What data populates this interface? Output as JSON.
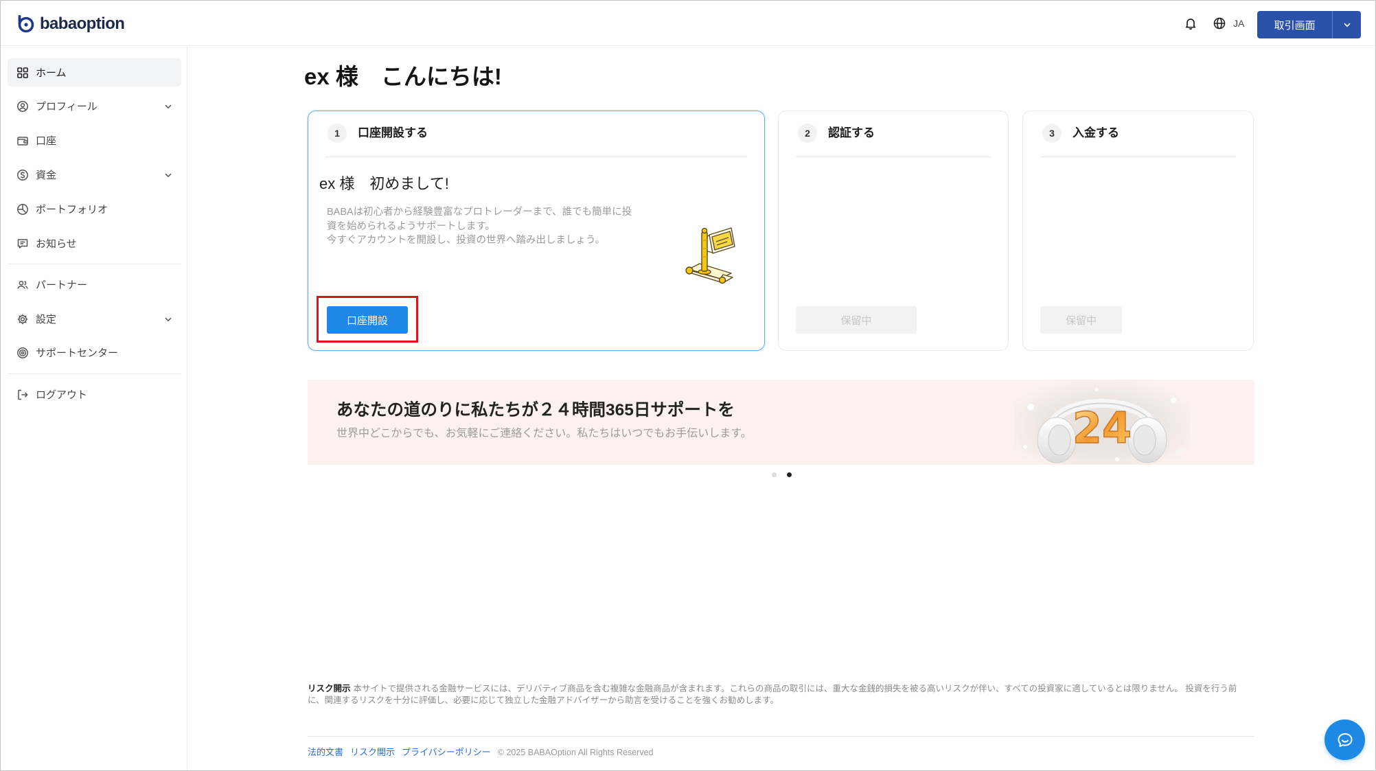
{
  "header": {
    "logo_text": "babaoption",
    "logo_icon": "babaoption-logo-icon",
    "notification_icon": "bell-icon",
    "language_icon": "globe-icon",
    "language": "JA",
    "trade_button_label": "取引画面",
    "trade_button_icon": "chevron-down-icon"
  },
  "sidebar": {
    "items": [
      {
        "label": "ホーム",
        "icon": "grid-icon",
        "active": true
      },
      {
        "label": "プロフィール",
        "icon": "user-circle-icon",
        "expandable": true
      },
      {
        "label": "口座",
        "icon": "wallet-icon"
      },
      {
        "label": "資金",
        "icon": "dollar-circle-icon",
        "expandable": true
      },
      {
        "label": "ポートフォリオ",
        "icon": "pie-chart-icon"
      },
      {
        "label": "お知らせ",
        "icon": "message-icon"
      },
      {
        "label": "パートナー",
        "icon": "users-icon"
      },
      {
        "label": "設定",
        "icon": "gear-icon",
        "expandable": true
      },
      {
        "label": "サポートセンター",
        "icon": "support-icon"
      },
      {
        "label": "ログアウト",
        "icon": "logout-icon"
      }
    ]
  },
  "main": {
    "greeting": "ex 様　こんにちは!",
    "steps": [
      {
        "number": "1",
        "title": "口座開設する",
        "active": true
      },
      {
        "number": "2",
        "title": "認証する",
        "button_label": "保留中"
      },
      {
        "number": "3",
        "title": "入金する",
        "button_label": "保留中"
      }
    ],
    "welcome": {
      "title": "ex 様　初めまして!",
      "description_1": "BABAは初心者から経験豊富なプロトレーダーまで、誰でも簡単に投資を始められるようサポートします。",
      "description_2": "今すぐアカウントを開設し、投資の世界へ踏み出しましょう。",
      "button_label": "口座開設"
    },
    "banner": {
      "title": "あなたの道のりに私たちが２４時間365日サポートを",
      "subtitle": "世界中どこからでも、お気軽にご連絡ください。私たちはいつでもお手伝いします。",
      "image_text": "24"
    },
    "carousel": {
      "count": 2,
      "active_index": 1
    }
  },
  "footer": {
    "risk_label": "リスク開示",
    "risk_text": "本サイトで提供される金融サービスには、デリバティブ商品を含む複雑な金融商品が含まれます。これらの商品の取引には、重大な金銭的損失を被る高いリスクが伴い、すべての投資家に適しているとは限りません。 投資を行う前に、関連するリスクを十分に評価し、必要に応じて独立した金融アドバイザーから助言を受けることを強くお勧めします。",
    "links": [
      {
        "label": "法的文書"
      },
      {
        "label": "リスク開示"
      },
      {
        "label": "プライバシーポリシー"
      }
    ],
    "copyright": "© 2025 BABAOption All Rights Reserved",
    "chat_icon": "chat-bubble-icon"
  },
  "colors": {
    "primary": "#1f87e6",
    "header_button": "#2b52a8",
    "active_card_border": "#63abe8",
    "highlight": "#e0121b",
    "banner_bg": "#fdf2ef",
    "link": "#2a6fd6"
  }
}
